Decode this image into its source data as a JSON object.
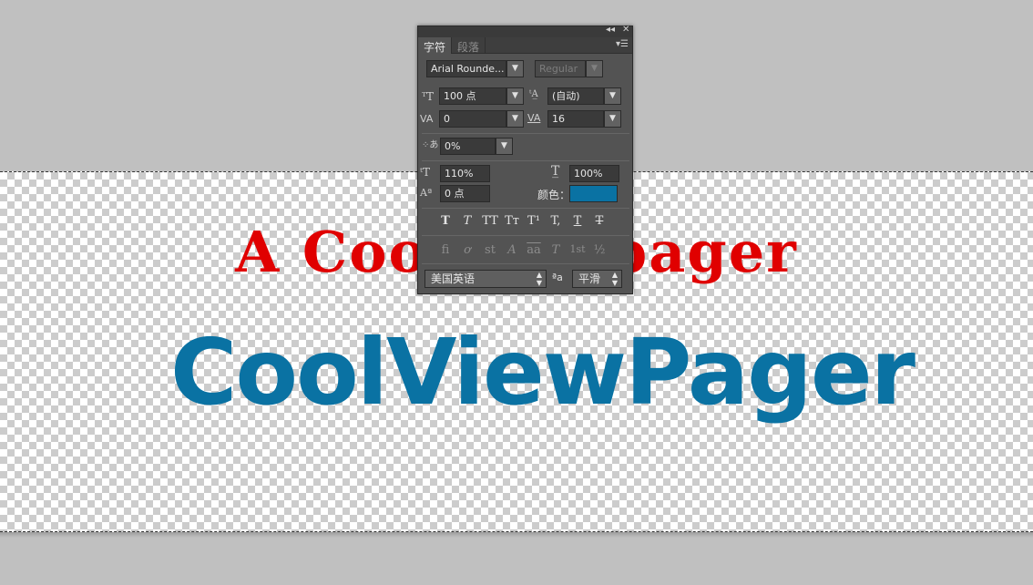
{
  "canvas": {
    "line1": "A CoolViewpager",
    "line2": "CoolViewPager",
    "line1_color": "#e00000",
    "line2_color": "#0a72a3"
  },
  "panel": {
    "collapse_icon": "double-left-arrow-icon",
    "close_icon": "close-icon",
    "tabs": [
      "字符",
      "段落"
    ],
    "menu_icon": "panel-menu-icon",
    "font_family": "Arial Rounde...",
    "font_style": "Regular",
    "font_size": "100 点",
    "leading": "(自动)",
    "kerning": "0",
    "tracking": "16",
    "tsume": "0%",
    "vertical_scale": "110%",
    "horizontal_scale": "100%",
    "baseline_shift": "0 点",
    "color_label": "颜色：",
    "color_value": "#0a72a3",
    "style_buttons": [
      "T",
      "T",
      "TT",
      "Tт",
      "T¹",
      "T,",
      "T",
      "T"
    ],
    "opentype_buttons": [
      "fi",
      "ơ",
      "st",
      "A",
      "aa",
      "T",
      "1st",
      "½"
    ],
    "language": "美国英语",
    "aa_label": "ªa",
    "antialias": "平滑"
  }
}
